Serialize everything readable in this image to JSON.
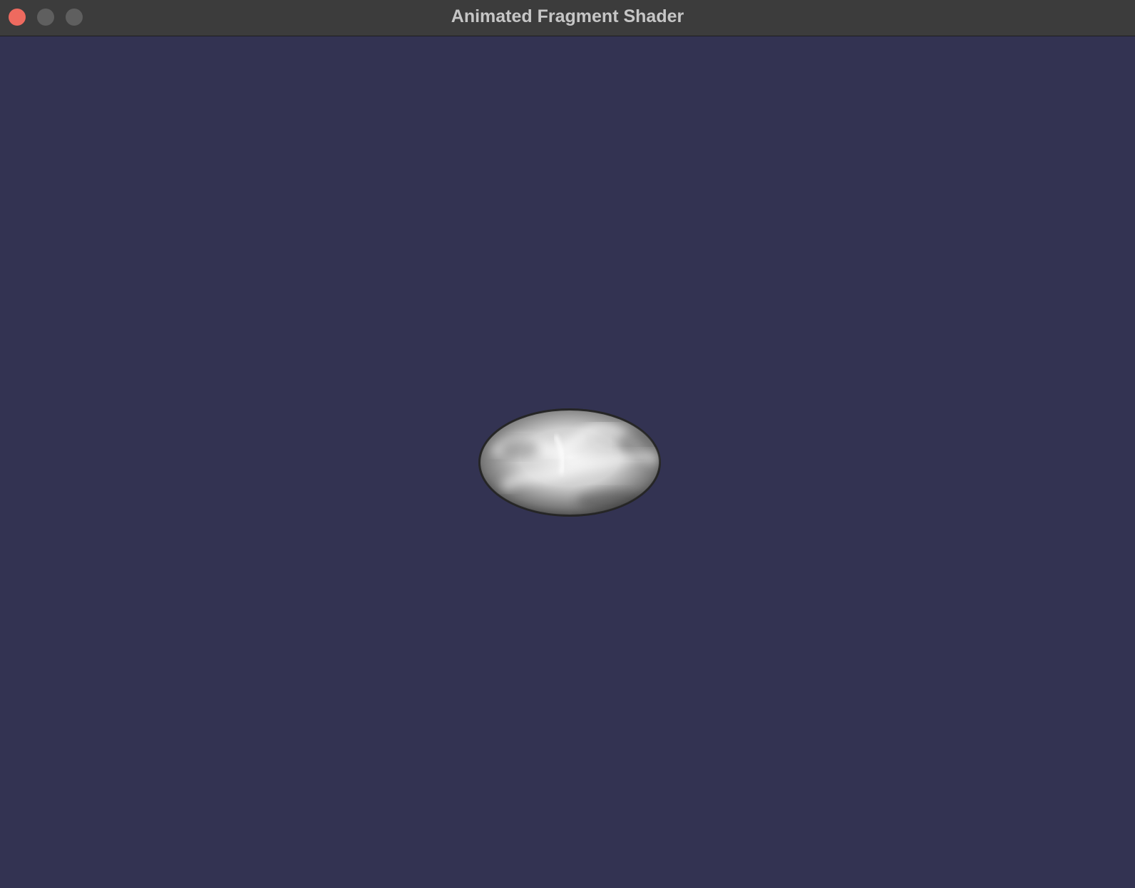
{
  "window": {
    "title": "Animated Fragment Shader",
    "controls": {
      "close_icon": "close-icon",
      "minimize_icon": "minimize-icon",
      "zoom_icon": "zoom-icon"
    }
  },
  "colors": {
    "titlebar": "#3c3c3c",
    "close": "#ee6a5f",
    "inactive_control": "#5f5f5f",
    "background": "#333352",
    "shape_light": "#f4f4f4",
    "shape_dark": "#3a3a3a"
  },
  "canvas": {
    "shape": "ellipse"
  }
}
